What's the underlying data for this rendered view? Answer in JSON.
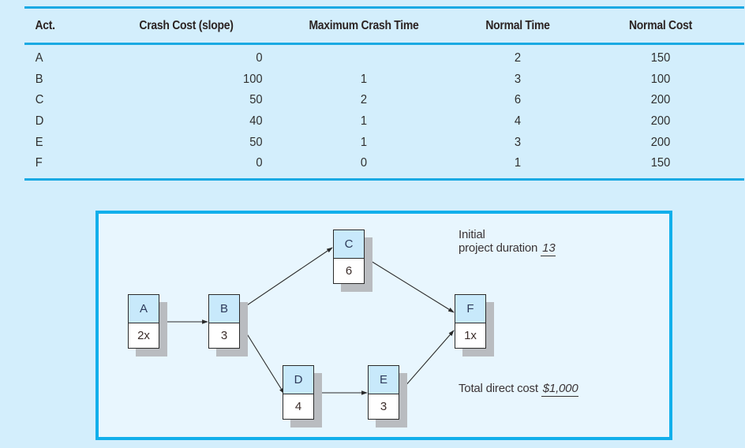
{
  "table": {
    "headers": [
      "Act.",
      "Crash Cost (slope)",
      "Maximum Crash Time",
      "Normal Time",
      "Normal Cost"
    ],
    "rows": [
      {
        "act": "A",
        "crash_cost": "0",
        "max_crash_time": "",
        "normal_time": "2",
        "normal_cost": "150"
      },
      {
        "act": "B",
        "crash_cost": "100",
        "max_crash_time": "1",
        "normal_time": "3",
        "normal_cost": "100"
      },
      {
        "act": "C",
        "crash_cost": "50",
        "max_crash_time": "2",
        "normal_time": "6",
        "normal_cost": "200"
      },
      {
        "act": "D",
        "crash_cost": "40",
        "max_crash_time": "1",
        "normal_time": "4",
        "normal_cost": "200"
      },
      {
        "act": "E",
        "crash_cost": "50",
        "max_crash_time": "1",
        "normal_time": "3",
        "normal_cost": "200"
      },
      {
        "act": "F",
        "crash_cost": "0",
        "max_crash_time": "0",
        "normal_time": "1",
        "normal_cost": "150"
      }
    ],
    "rule_color": "#1aa9e3"
  },
  "diagram": {
    "frame_color": "#12afeb",
    "nodes": [
      {
        "id": "A",
        "label": "A",
        "duration": "2x"
      },
      {
        "id": "B",
        "label": "B",
        "duration": "3"
      },
      {
        "id": "C",
        "label": "C",
        "duration": "6"
      },
      {
        "id": "D",
        "label": "D",
        "duration": "4"
      },
      {
        "id": "E",
        "label": "E",
        "duration": "3"
      },
      {
        "id": "F",
        "label": "F",
        "duration": "1x"
      }
    ],
    "edges": [
      {
        "from": "A",
        "to": "B"
      },
      {
        "from": "B",
        "to": "C"
      },
      {
        "from": "B",
        "to": "D"
      },
      {
        "from": "C",
        "to": "F"
      },
      {
        "from": "D",
        "to": "E"
      },
      {
        "from": "E",
        "to": "F"
      }
    ],
    "duration_note": {
      "line1": "Initial",
      "line2": "project duration",
      "value": "13"
    },
    "cost_note": {
      "label": "Total direct cost",
      "value": "$1,000"
    },
    "header_fill": "#c8e9fb"
  }
}
